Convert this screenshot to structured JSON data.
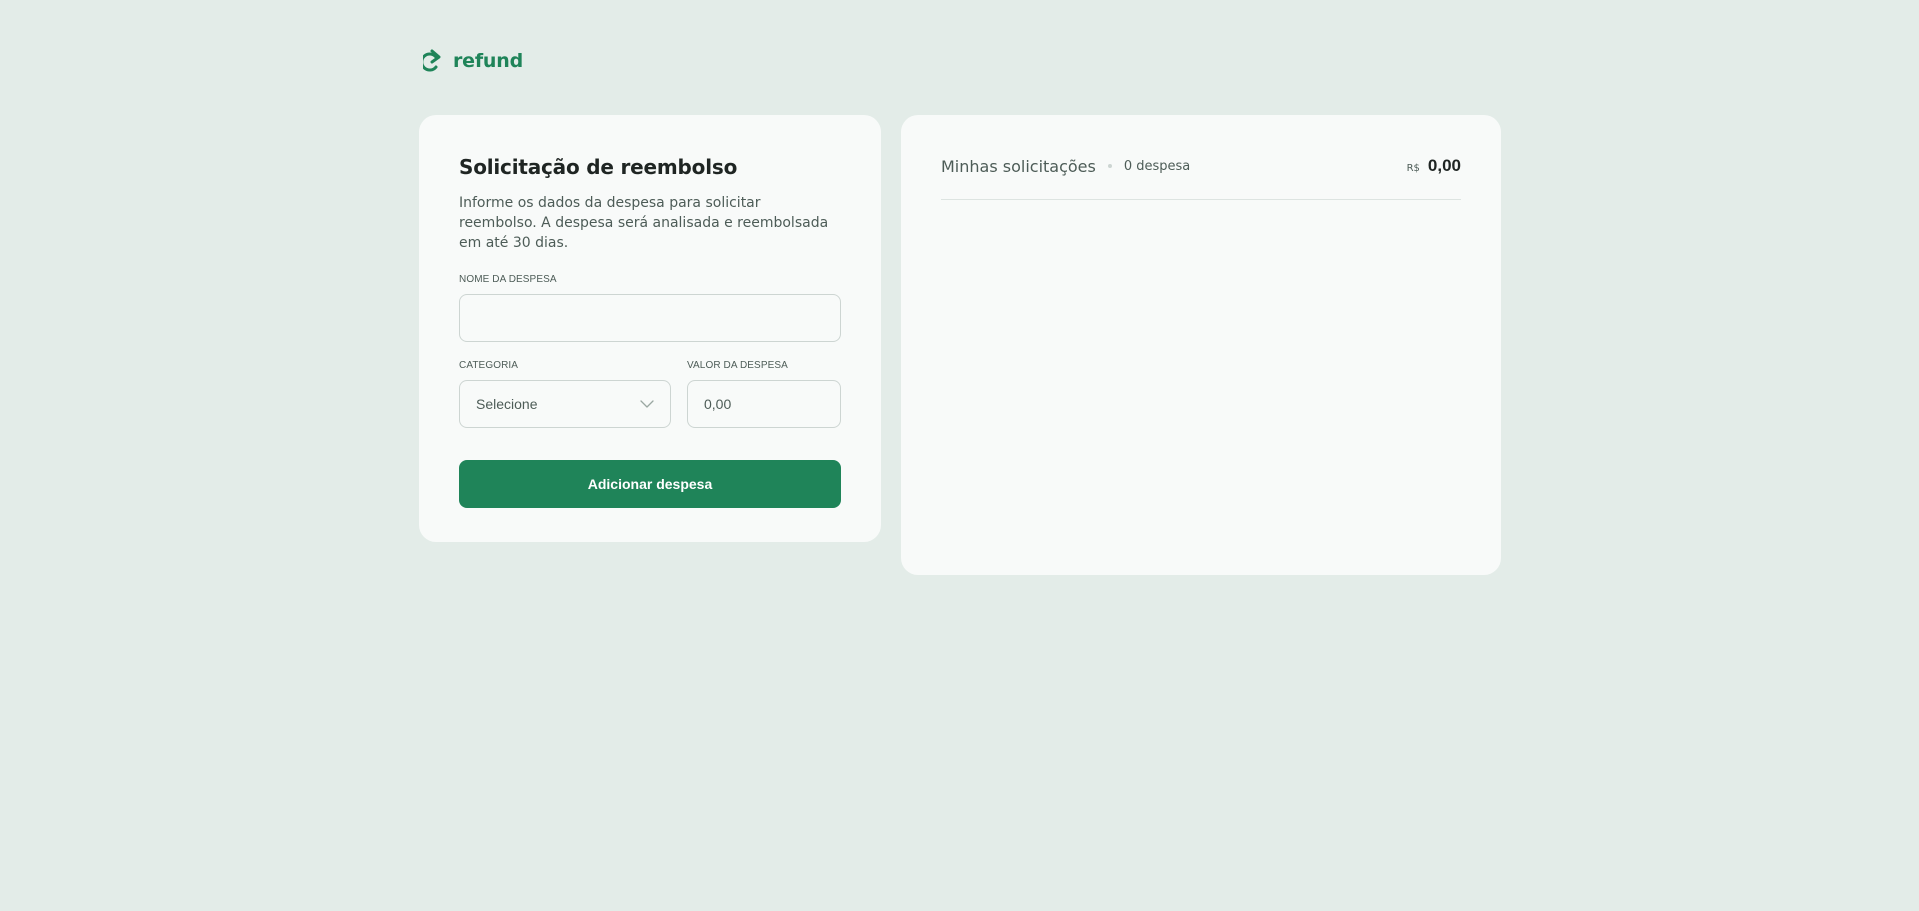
{
  "brand": {
    "name": "refund",
    "color": "#1f8459"
  },
  "form": {
    "title": "Solicitação de reembolso",
    "description": "Informe os dados da despesa para solicitar reembolso. A despesa será analisada e reembolsada em até 30 dias.",
    "expense_name": {
      "label": "NOME DA DESPESA",
      "value": ""
    },
    "category": {
      "label": "CATEGORIA",
      "selected": "Selecione"
    },
    "amount": {
      "label": "VALOR DA DESPESA",
      "placeholder": "0,00"
    },
    "submit_label": "Adicionar despesa"
  },
  "requests": {
    "title": "Minhas solicitações",
    "count_text": "0 despesa",
    "currency": "R$",
    "total": "0,00"
  }
}
